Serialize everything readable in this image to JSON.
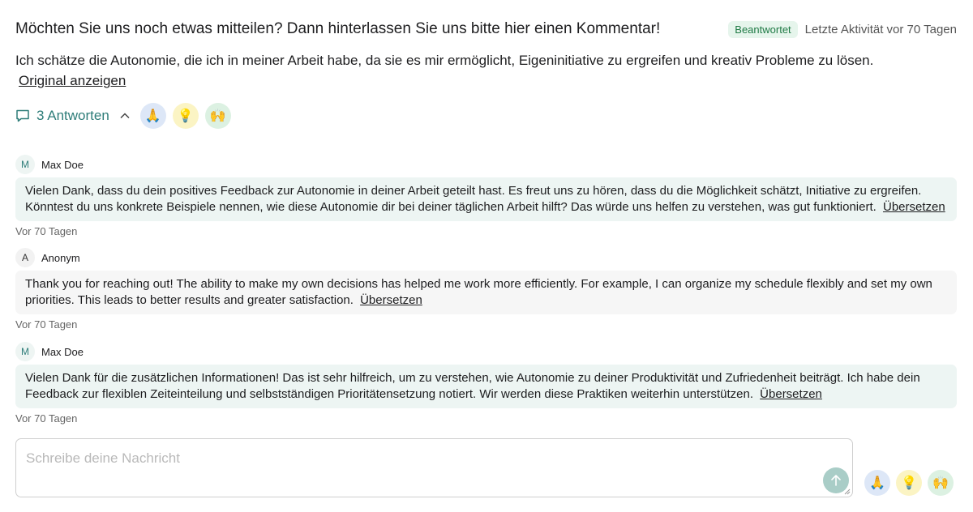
{
  "header": {
    "question": "Möchten Sie uns noch etwas mitteilen? Dann hinterlassen Sie uns bitte hier einen Kommentar!",
    "status_badge": "Beantwortet",
    "last_activity": "Letzte Aktivität vor 70 Tagen"
  },
  "answer": {
    "text": "Ich schätze die Autonomie, die ich in meiner Arbeit habe, da sie es mir ermöglicht, Eigeninitiative zu ergreifen und kreativ Probleme zu lösen.",
    "original_link": "Original anzeigen"
  },
  "replies": {
    "count_label": "3 Antworten",
    "reactions": [
      "🙏",
      "💡",
      "🙌"
    ]
  },
  "messages": [
    {
      "avatar": "M",
      "author": "Max Doe",
      "text": "Vielen Dank, dass du dein positives Feedback zur Autonomie in deiner Arbeit geteilt hast. Es freut uns zu hören, dass du die Möglichkeit schätzt, Initiative zu ergreifen. Könntest du uns konkrete Beispiele nennen, wie diese Autonomie dir bei deiner täglichen Arbeit hilft? Das würde uns helfen zu verstehen, was gut funktioniert.",
      "translate": "Übersetzen",
      "time": "Vor 70 Tagen"
    },
    {
      "avatar": "A",
      "author": "Anonym",
      "text": "Thank you for reaching out! The ability to make my own decisions has helped me work more efficiently. For example, I can organize my schedule flexibly and set my own priorities. This leads to better results and greater satisfaction.",
      "translate": "Übersetzen",
      "time": "Vor 70 Tagen"
    },
    {
      "avatar": "M",
      "author": "Max Doe",
      "text": "Vielen Dank für die zusätzlichen Informationen! Das ist sehr hilfreich, um zu verstehen, wie Autonomie zu deiner Produktivität und Zufriedenheit beiträgt. Ich habe dein Feedback zur flexiblen Zeiteinteilung und selbstständigen Prioritätensetzung notiert. Wir werden diese Praktiken weiterhin unterstützen.",
      "translate": "Übersetzen",
      "time": "Vor 70 Tagen"
    }
  ],
  "composer": {
    "placeholder": "Schreibe deine Nachricht",
    "value": "",
    "reactions": [
      "🙏",
      "💡",
      "🙌"
    ]
  },
  "colors": {
    "accent": "#2e7d79",
    "status_badge_bg": "#e6f5ec",
    "bubble_team": "#edf5f3",
    "bubble_user": "#f6f6f6"
  }
}
